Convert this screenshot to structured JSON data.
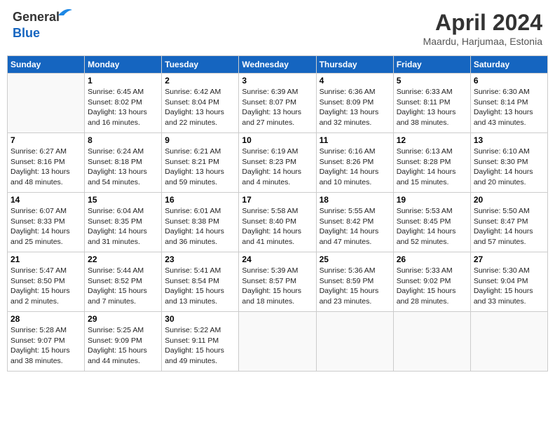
{
  "header": {
    "logo_line1": "General",
    "logo_line2": "Blue",
    "month_title": "April 2024",
    "location": "Maardu, Harjumaa, Estonia"
  },
  "weekdays": [
    "Sunday",
    "Monday",
    "Tuesday",
    "Wednesday",
    "Thursday",
    "Friday",
    "Saturday"
  ],
  "weeks": [
    [
      {
        "day": "",
        "sunrise": "",
        "sunset": "",
        "daylight": ""
      },
      {
        "day": "1",
        "sunrise": "6:45 AM",
        "sunset": "8:02 PM",
        "daylight": "13 hours and 16 minutes."
      },
      {
        "day": "2",
        "sunrise": "6:42 AM",
        "sunset": "8:04 PM",
        "daylight": "13 hours and 22 minutes."
      },
      {
        "day": "3",
        "sunrise": "6:39 AM",
        "sunset": "8:07 PM",
        "daylight": "13 hours and 27 minutes."
      },
      {
        "day": "4",
        "sunrise": "6:36 AM",
        "sunset": "8:09 PM",
        "daylight": "13 hours and 32 minutes."
      },
      {
        "day": "5",
        "sunrise": "6:33 AM",
        "sunset": "8:11 PM",
        "daylight": "13 hours and 38 minutes."
      },
      {
        "day": "6",
        "sunrise": "6:30 AM",
        "sunset": "8:14 PM",
        "daylight": "13 hours and 43 minutes."
      }
    ],
    [
      {
        "day": "7",
        "sunrise": "6:27 AM",
        "sunset": "8:16 PM",
        "daylight": "13 hours and 48 minutes."
      },
      {
        "day": "8",
        "sunrise": "6:24 AM",
        "sunset": "8:18 PM",
        "daylight": "13 hours and 54 minutes."
      },
      {
        "day": "9",
        "sunrise": "6:21 AM",
        "sunset": "8:21 PM",
        "daylight": "13 hours and 59 minutes."
      },
      {
        "day": "10",
        "sunrise": "6:19 AM",
        "sunset": "8:23 PM",
        "daylight": "14 hours and 4 minutes."
      },
      {
        "day": "11",
        "sunrise": "6:16 AM",
        "sunset": "8:26 PM",
        "daylight": "14 hours and 10 minutes."
      },
      {
        "day": "12",
        "sunrise": "6:13 AM",
        "sunset": "8:28 PM",
        "daylight": "14 hours and 15 minutes."
      },
      {
        "day": "13",
        "sunrise": "6:10 AM",
        "sunset": "8:30 PM",
        "daylight": "14 hours and 20 minutes."
      }
    ],
    [
      {
        "day": "14",
        "sunrise": "6:07 AM",
        "sunset": "8:33 PM",
        "daylight": "14 hours and 25 minutes."
      },
      {
        "day": "15",
        "sunrise": "6:04 AM",
        "sunset": "8:35 PM",
        "daylight": "14 hours and 31 minutes."
      },
      {
        "day": "16",
        "sunrise": "6:01 AM",
        "sunset": "8:38 PM",
        "daylight": "14 hours and 36 minutes."
      },
      {
        "day": "17",
        "sunrise": "5:58 AM",
        "sunset": "8:40 PM",
        "daylight": "14 hours and 41 minutes."
      },
      {
        "day": "18",
        "sunrise": "5:55 AM",
        "sunset": "8:42 PM",
        "daylight": "14 hours and 47 minutes."
      },
      {
        "day": "19",
        "sunrise": "5:53 AM",
        "sunset": "8:45 PM",
        "daylight": "14 hours and 52 minutes."
      },
      {
        "day": "20",
        "sunrise": "5:50 AM",
        "sunset": "8:47 PM",
        "daylight": "14 hours and 57 minutes."
      }
    ],
    [
      {
        "day": "21",
        "sunrise": "5:47 AM",
        "sunset": "8:50 PM",
        "daylight": "15 hours and 2 minutes."
      },
      {
        "day": "22",
        "sunrise": "5:44 AM",
        "sunset": "8:52 PM",
        "daylight": "15 hours and 7 minutes."
      },
      {
        "day": "23",
        "sunrise": "5:41 AM",
        "sunset": "8:54 PM",
        "daylight": "15 hours and 13 minutes."
      },
      {
        "day": "24",
        "sunrise": "5:39 AM",
        "sunset": "8:57 PM",
        "daylight": "15 hours and 18 minutes."
      },
      {
        "day": "25",
        "sunrise": "5:36 AM",
        "sunset": "8:59 PM",
        "daylight": "15 hours and 23 minutes."
      },
      {
        "day": "26",
        "sunrise": "5:33 AM",
        "sunset": "9:02 PM",
        "daylight": "15 hours and 28 minutes."
      },
      {
        "day": "27",
        "sunrise": "5:30 AM",
        "sunset": "9:04 PM",
        "daylight": "15 hours and 33 minutes."
      }
    ],
    [
      {
        "day": "28",
        "sunrise": "5:28 AM",
        "sunset": "9:07 PM",
        "daylight": "15 hours and 38 minutes."
      },
      {
        "day": "29",
        "sunrise": "5:25 AM",
        "sunset": "9:09 PM",
        "daylight": "15 hours and 44 minutes."
      },
      {
        "day": "30",
        "sunrise": "5:22 AM",
        "sunset": "9:11 PM",
        "daylight": "15 hours and 49 minutes."
      },
      {
        "day": "",
        "sunrise": "",
        "sunset": "",
        "daylight": ""
      },
      {
        "day": "",
        "sunrise": "",
        "sunset": "",
        "daylight": ""
      },
      {
        "day": "",
        "sunrise": "",
        "sunset": "",
        "daylight": ""
      },
      {
        "day": "",
        "sunrise": "",
        "sunset": "",
        "daylight": ""
      }
    ]
  ]
}
